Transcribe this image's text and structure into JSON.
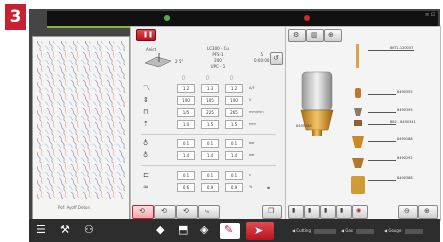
{
  "step_badge": "3",
  "pattern": {
    "caption": "Pof: Ayoff Deton"
  },
  "process": {
    "label_top": "Anict",
    "angle": "2 5°",
    "params": [
      "LC300 - Cu",
      "PFS-1",
      "200",
      "UPC - 1"
    ],
    "right": [
      "5",
      "0:00:00"
    ]
  },
  "table": {
    "rows": [
      {
        "icon": "amperage-icon",
        "values": [
          "1.2",
          "1.3",
          "1.2"
        ],
        "unit": "A/F"
      },
      {
        "icon": "voltage-icon",
        "values": [
          "100",
          "105",
          "100"
        ],
        "unit": "V"
      },
      {
        "icon": "speed-icon",
        "values": [
          "1/5",
          "225",
          "265"
        ],
        "unit": "mm/min"
      },
      {
        "icon": "height-icon",
        "values": [
          "1.0",
          "1.5",
          "1.5"
        ],
        "unit": "mm"
      },
      {
        "icon": "gas-icon",
        "values": [
          "0.1",
          "0.1",
          "0.1"
        ],
        "unit": "bar"
      },
      {
        "icon": "gas-flow-icon",
        "values": [
          "1.4",
          "1.4",
          "1.4"
        ],
        "unit": "bar"
      },
      {
        "icon": "pierce-time-icon",
        "values": [
          "0.1",
          "0.1",
          "0.1"
        ],
        "unit": "s"
      },
      {
        "icon": "pierce-height-icon",
        "values": [
          "0.6",
          "0.9",
          "0.9"
        ],
        "unit": "%"
      }
    ]
  },
  "consumables": {
    "parts": [
      {
        "label": "8KT1-120037"
      },
      {
        "label": "8490355"
      },
      {
        "label": "8490395"
      },
      {
        "label": "882 - 8490341"
      },
      {
        "label": "8490188"
      },
      {
        "label": "8490292"
      },
      {
        "label": "8490388"
      }
    ],
    "assembly_label": "8490388"
  },
  "footer": {
    "fields": [
      {
        "label": "◀ Cutting"
      },
      {
        "label": "◀ Gas"
      },
      {
        "label": "◀ Gouge"
      }
    ]
  }
}
